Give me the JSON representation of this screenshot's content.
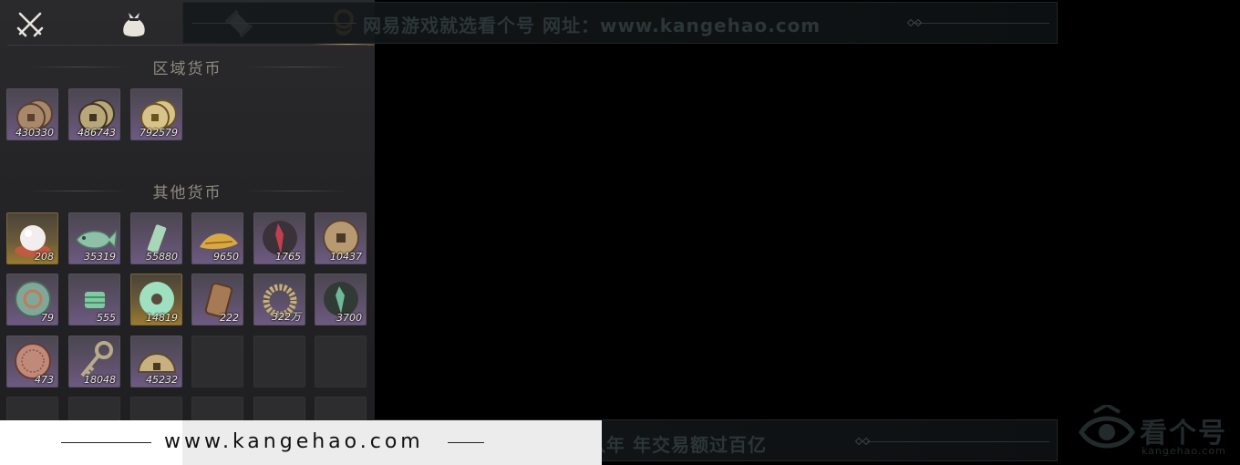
{
  "tabs": [
    {
      "name": "crossed-swords-icon",
      "active": false
    },
    {
      "name": "money-pouch-icon",
      "active": false
    },
    {
      "name": "scroll-icon",
      "active": false
    },
    {
      "name": "currency-coin-icon",
      "active": true
    }
  ],
  "regional": {
    "title": "区域货币",
    "items": [
      {
        "icon": "copper-coins-icon",
        "count": "430330",
        "rarity": "purple"
      },
      {
        "icon": "bronze-coins-icon",
        "count": "486743",
        "rarity": "purple"
      },
      {
        "icon": "gold-coins-icon",
        "count": "792579",
        "rarity": "purple"
      }
    ]
  },
  "other": {
    "title": "其他货币",
    "items": [
      {
        "icon": "pearl-icon",
        "count": "208",
        "rarity": "gold"
      },
      {
        "icon": "jade-fish-icon",
        "count": "35319",
        "rarity": "purple"
      },
      {
        "icon": "jade-tablet-icon",
        "count": "55880",
        "rarity": "purple"
      },
      {
        "icon": "golden-grain-icon",
        "count": "9650",
        "rarity": "purple"
      },
      {
        "icon": "red-shard-icon",
        "count": "1765",
        "rarity": "purple"
      },
      {
        "icon": "old-coin-icon",
        "count": "10437",
        "rarity": "purple"
      },
      {
        "icon": "jade-medallion-icon",
        "count": "79",
        "rarity": "purple"
      },
      {
        "icon": "jade-ticket-icon",
        "count": "555",
        "rarity": "purple"
      },
      {
        "icon": "jade-ring-icon",
        "count": "14819",
        "rarity": "gold"
      },
      {
        "icon": "bronze-token-icon",
        "count": "222",
        "rarity": "purple"
      },
      {
        "icon": "bead-bracelet-icon",
        "count": "322万",
        "rarity": "purple"
      },
      {
        "icon": "green-shard-icon",
        "count": "3700",
        "rarity": "purple"
      },
      {
        "icon": "copper-disc-icon",
        "count": "473",
        "rarity": "purple"
      },
      {
        "icon": "bronze-key-icon",
        "count": "18048",
        "rarity": "purple"
      },
      {
        "icon": "half-coin-icon",
        "count": "45232",
        "rarity": "purple"
      }
    ]
  },
  "watermark": {
    "top_text": "网易游戏就选看个号   网址：www.kangehao.com",
    "bottom_text": "看个号专业网易游戏八年   年交易额过百亿",
    "url": "www.kangehao.com",
    "brand_name": "看个号",
    "brand_sub": "kangehao.com"
  },
  "colors": {
    "accent_gold": "#c9a050",
    "rarity_purple": "#6d5a82",
    "rarity_gold": "#9a7a30"
  }
}
